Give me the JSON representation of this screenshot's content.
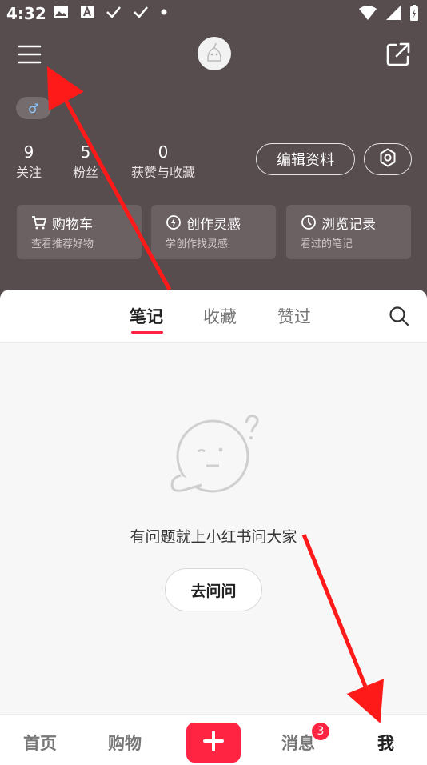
{
  "status_bar": {
    "time": "4:32"
  },
  "profile": {
    "gender_symbol": "♂",
    "stats": [
      {
        "value": "9",
        "label": "关注"
      },
      {
        "value": "5",
        "label": "粉丝"
      },
      {
        "value": "0",
        "label": "获赞与收藏"
      }
    ],
    "edit_button": "编辑资料"
  },
  "cards": [
    {
      "title": "购物车",
      "subtitle": "查看推荐好物",
      "icon": "cart-icon"
    },
    {
      "title": "创作灵感",
      "subtitle": "学创作找灵感",
      "icon": "lightning-icon"
    },
    {
      "title": "浏览记录",
      "subtitle": "看过的笔记",
      "icon": "clock-icon"
    }
  ],
  "tabs": [
    {
      "label": "笔记"
    },
    {
      "label": "收藏"
    },
    {
      "label": "赞过"
    }
  ],
  "empty_state": {
    "message": "有问题就上小红书问大家",
    "button": "去问问"
  },
  "bottom_nav": {
    "home": "首页",
    "shop": "购物",
    "messages": "消息",
    "messages_badge": "3",
    "me": "我"
  },
  "colors": {
    "accent": "#ff2442",
    "header_bg": "#574c4e",
    "annotation_arrow": "#ff1a1a"
  }
}
